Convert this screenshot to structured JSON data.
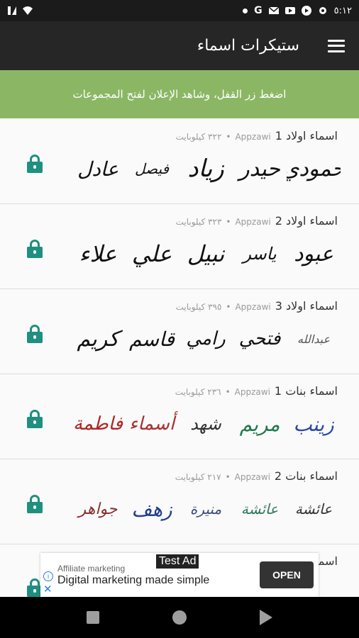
{
  "status_bar": {
    "time": "٥:١٢",
    "left_icons": [
      "sim-icon",
      "wifi-icon"
    ],
    "right_icons": [
      "notification-dot-icon",
      "google-icon",
      "mail-icon",
      "youtube-icon",
      "pause-icon",
      "settings-icon"
    ],
    "google_letter": "G"
  },
  "toolbar": {
    "title": "ستيكرات اسماء",
    "menu_icon": "menu-icon"
  },
  "banner": {
    "text": "اضغط زر القفل، وشاهد الإعلان لفتح المجموعات"
  },
  "packs": [
    {
      "name": "اسماء اولاد 1",
      "publisher": "Appzawi",
      "size": "٣٢٢ كيلوبايت",
      "stickers": [
        {
          "text": "حمودي",
          "color": "#111111",
          "size": 30
        },
        {
          "text": "حيدر",
          "color": "#111111",
          "size": 30
        },
        {
          "text": "زياد",
          "color": "#111111",
          "size": 34
        },
        {
          "text": "فيصل",
          "color": "#111111",
          "size": 20
        },
        {
          "text": "عادل",
          "color": "#111111",
          "size": 28
        }
      ]
    },
    {
      "name": "اسماء اولاد 2",
      "publisher": "Appzawi",
      "size": "٣٢٣ كيلوبايت",
      "stickers": [
        {
          "text": "عبود",
          "color": "#111111",
          "size": 30
        },
        {
          "text": "ياسر",
          "color": "#111111",
          "size": 24
        },
        {
          "text": "نبيل",
          "color": "#111111",
          "size": 32
        },
        {
          "text": "علي",
          "color": "#111111",
          "size": 32
        },
        {
          "text": "علاء",
          "color": "#111111",
          "size": 32
        }
      ]
    },
    {
      "name": "اسماء اولاد 3",
      "publisher": "Appzawi",
      "size": "٣٩٥ كيلوبايت",
      "stickers": [
        {
          "text": "عبدالله",
          "color": "#555555",
          "size": 16
        },
        {
          "text": "فتحي",
          "color": "#111111",
          "size": 26
        },
        {
          "text": "رامي",
          "color": "#111111",
          "size": 26
        },
        {
          "text": "قاسم",
          "color": "#111111",
          "size": 28
        },
        {
          "text": "كريم",
          "color": "#111111",
          "size": 30
        }
      ]
    },
    {
      "name": "اسماء بنات 1",
      "publisher": "Appzawi",
      "size": "٢٣٦ كيلوبايت",
      "stickers": [
        {
          "text": "زينب",
          "color": "#2b4aa8",
          "size": 28
        },
        {
          "text": "مريم",
          "color": "#1f7a4d",
          "size": 28
        },
        {
          "text": "شهد",
          "color": "#333333",
          "size": 24
        },
        {
          "text": "أسماء",
          "color": "#a83232",
          "size": 26
        },
        {
          "text": "فاطمة",
          "color": "#b02424",
          "size": 26
        }
      ]
    },
    {
      "name": "اسماء بنات 2",
      "publisher": "Appzawi",
      "size": "٢١٧ كيلوبايت",
      "stickers": [
        {
          "text": "عائشة",
          "color": "#333333",
          "size": 20
        },
        {
          "text": "عائشة",
          "color": "#2f7a5a",
          "size": 20
        },
        {
          "text": "منيرة",
          "color": "#3a4a7a",
          "size": 20
        },
        {
          "text": "زهف",
          "color": "#1f3f8f",
          "size": 28
        },
        {
          "text": "جواهر",
          "color": "#8a2f2f",
          "size": 22
        }
      ]
    },
    {
      "name": "اسماء",
      "publisher": "",
      "size": "",
      "stickers": []
    }
  ],
  "ad": {
    "tag": "Test Ad",
    "label": "Affiliate marketing",
    "text": "Digital marketing made simple",
    "button": "OPEN",
    "info_icon": "info-icon",
    "close_icon": "close-icon"
  },
  "nav": {
    "buttons": [
      "recents-button",
      "home-button",
      "back-button"
    ]
  }
}
